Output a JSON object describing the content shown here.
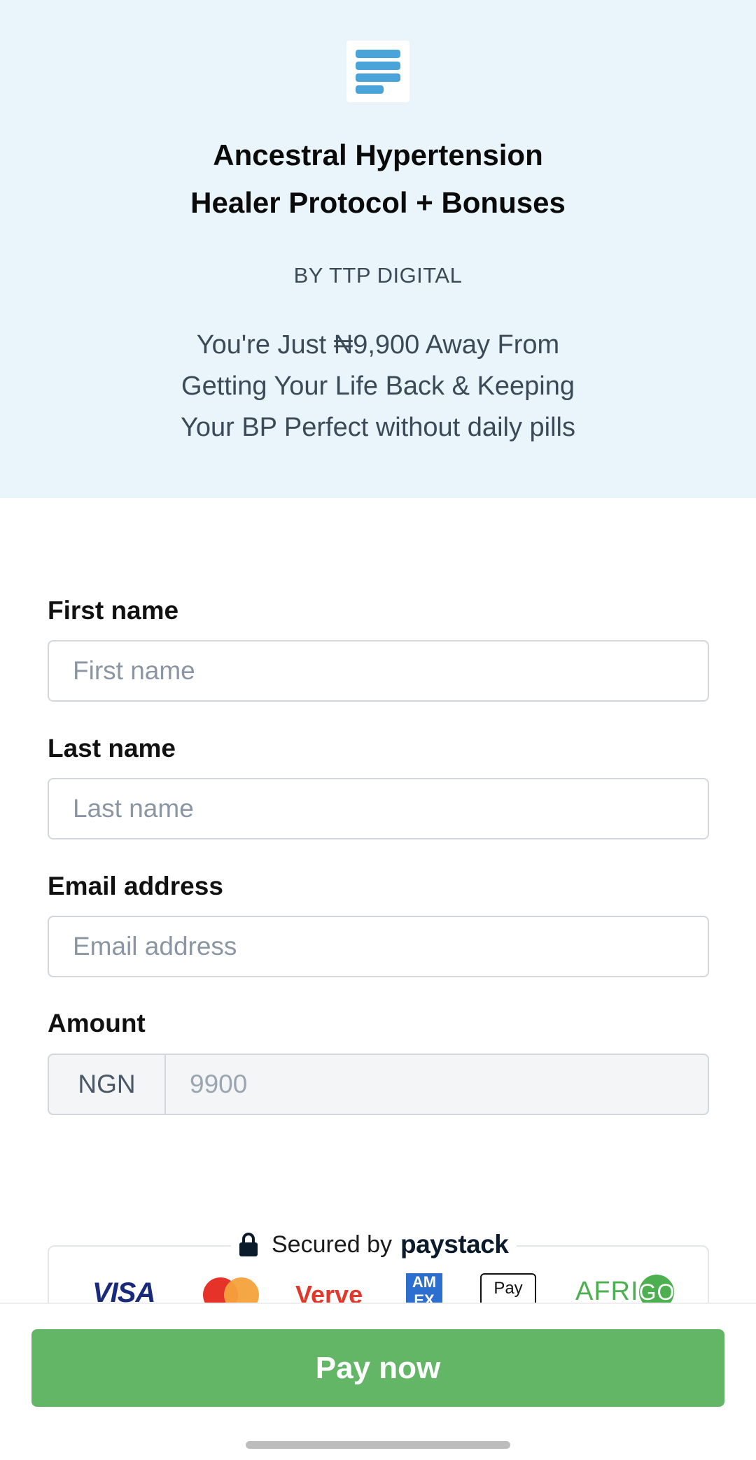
{
  "header": {
    "logo_icon": "menu-lines-logo",
    "title_line1": "Ancestral Hypertension",
    "title_line2": "Healer Protocol + Bonuses",
    "byline": "BY TTP DIGITAL",
    "tagline_line1": "You're Just ₦9,900 Away From",
    "tagline_line2": "Getting Your Life Back & Keeping",
    "tagline_line3": "Your BP Perfect without daily pills",
    "background_color": "#eaf4fb"
  },
  "form": {
    "first_name": {
      "label": "First name",
      "placeholder": "First name",
      "value": ""
    },
    "last_name": {
      "label": "Last name",
      "placeholder": "Last name",
      "value": ""
    },
    "email": {
      "label": "Email address",
      "placeholder": "Email address",
      "value": ""
    },
    "amount": {
      "label": "Amount",
      "currency": "NGN",
      "placeholder": "9900"
    }
  },
  "security": {
    "secured_by": "Secured by",
    "brand": "paystack",
    "payment_methods": [
      "VISA",
      "Mastercard",
      "Verve",
      "AMEX",
      "Apple Pay",
      "AFRIGO"
    ]
  },
  "payment_labels": {
    "visa": "VISA",
    "verve": "Verve",
    "amex": "AM EX",
    "applepay": " Pay",
    "afrigo_a": "AFRI",
    "afrigo_b": "GO"
  },
  "actions": {
    "pay_label": "Pay now",
    "pay_color": "#62b666"
  }
}
